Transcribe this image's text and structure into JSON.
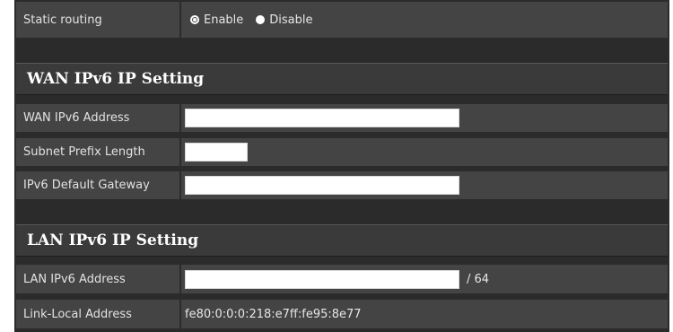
{
  "static_routing": {
    "label": "Static routing",
    "options": [
      {
        "label": "Enable",
        "selected": true
      },
      {
        "label": "Disable",
        "selected": false
      }
    ]
  },
  "wan": {
    "section_title": "WAN IPv6 IP Setting",
    "address_label": "WAN IPv6 Address",
    "address_value": "",
    "prefix_label": "Subnet Prefix Length",
    "prefix_value": "",
    "gateway_label": "IPv6 Default Gateway",
    "gateway_value": ""
  },
  "lan": {
    "section_title": "LAN IPv6 IP Setting",
    "address_label": "LAN IPv6 Address",
    "address_value": "",
    "address_suffix": "/ 64",
    "link_local_label": "Link-Local Address",
    "link_local_value": "fe80:0:0:0:218:e7ff:fe95:8e77"
  }
}
